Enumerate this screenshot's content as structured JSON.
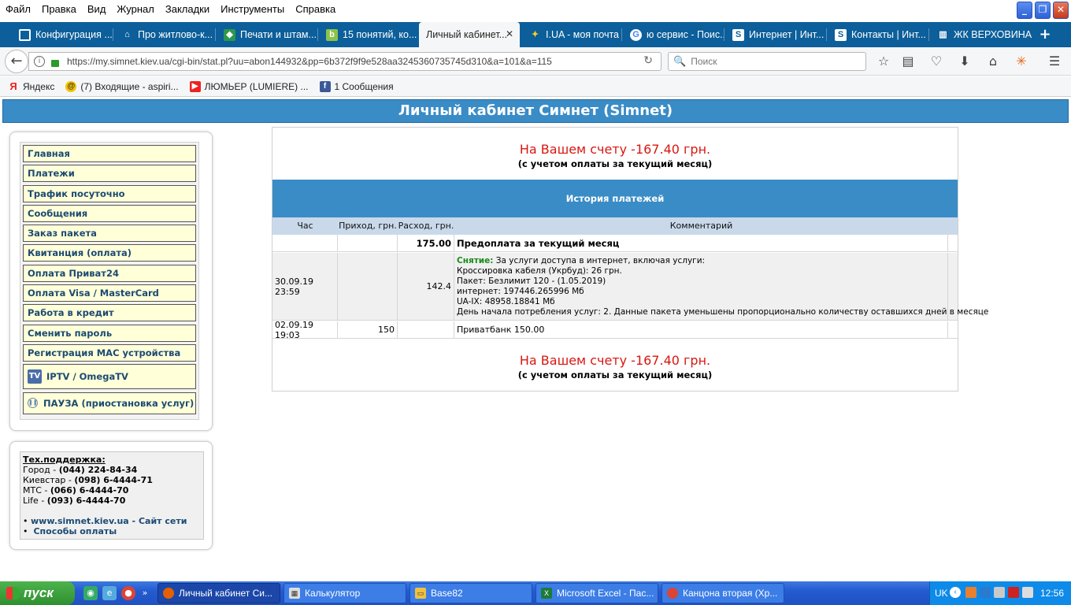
{
  "menu": [
    "Файл",
    "Правка",
    "Вид",
    "Журнал",
    "Закладки",
    "Инструменты",
    "Справка"
  ],
  "tabs": [
    {
      "label": "Конфигурация ...",
      "icon": "box"
    },
    {
      "label": "Про житлово-к...",
      "icon": "building"
    },
    {
      "label": "Печати и штам...",
      "icon": "stamp"
    },
    {
      "label": "15 понятий, ко...",
      "icon": "b"
    },
    {
      "label": "Личный кабинет...",
      "icon": "",
      "active": true
    },
    {
      "label": "I.UA - моя почта",
      "icon": "iua"
    },
    {
      "label": "ю сервис - Поис...",
      "icon": "google"
    },
    {
      "label": "Интернет | Инт...",
      "icon": "s"
    },
    {
      "label": "Контакты | Инт...",
      "icon": "s"
    },
    {
      "label": "ЖК ВЕРХОВИНА...",
      "icon": "book"
    }
  ],
  "url": "https://my.simnet.kiev.ua/cgi-bin/stat.pl?uu=abon144932&pp=6b372f9f9e528aa3245360735745d310&a=101&a=115",
  "search_placeholder": "Поиск",
  "bookmarks": [
    {
      "label": "Яндекс"
    },
    {
      "label": "(7) Входящие - aspiri..."
    },
    {
      "label": "ЛЮМЬЕР (LUMIERE) ..."
    },
    {
      "label": "1 Сообщения"
    }
  ],
  "page_title": "Личный кабинет Симнет (Simnet)",
  "nav": [
    "Главная",
    "Платежи",
    "Трафик посуточно",
    "Сообщения",
    "Заказ пакета",
    "Квитанция (оплата)",
    "Оплата Приват24",
    "Оплата Visa / MasterCard",
    "Работа в кредит",
    "Сменить пароль",
    "Регистрация MAC устройства",
    "IPTV / OmegaTV",
    "ПАУЗА (приостановка услуг)"
  ],
  "support": {
    "title": "Тех.поддержка:",
    "lines": [
      {
        "label": "Город - ",
        "phone": "(044) 224-84-34"
      },
      {
        "label": "Киевстар - ",
        "phone": "(098) 6-4444-71"
      },
      {
        "label": "МТС - ",
        "phone": "(066) 6-4444-70"
      },
      {
        "label": "Life - ",
        "phone": "(093) 6-4444-70"
      }
    ],
    "link1": "www.simnet.kiev.ua - Сайт сети",
    "link2": "Способы оплаты"
  },
  "balance": {
    "text": "На Вашем счету -167.40 грн.",
    "note": "(с учетом оплаты за текущий месяц)"
  },
  "history": {
    "title": "История платежей",
    "cols": [
      "Час",
      "Приход, грн.",
      "Расход, грн.",
      "Комментарий"
    ],
    "row1": {
      "out": "175.00",
      "comment": "Предоплата за текущий месяц"
    },
    "row2": {
      "time": "30.09.19 23:59",
      "out": "142.4",
      "label": "Снятие:",
      "l1": " За услуги доступа в интернет, включая услуги:",
      "l2": "Кроссировка кабеля (Укрбуд): 26 грн.",
      "l3": "Пакет: Безлимит 120 - (1.05.2019)",
      "l4": "интернет: 197446.265996 Мб",
      "l5": "UA-IX: 48958.18841 Мб",
      "l6": "День начала потребления услуг: 2. Данные пакета уменьшены пропорционально количеству оставшихся дней в месяце"
    },
    "row3": {
      "time": "02.09.19 19:03",
      "in": "150",
      "comment": "Приватбанк 150.00"
    }
  },
  "taskbar": {
    "start": "пуск",
    "items": [
      "Личный кабинет Си...",
      "Калькулятор",
      "Base82",
      "Microsoft Excel - Пас...",
      "Канцона вторая (Хр..."
    ],
    "lang": "UK",
    "clock": "12:56"
  }
}
